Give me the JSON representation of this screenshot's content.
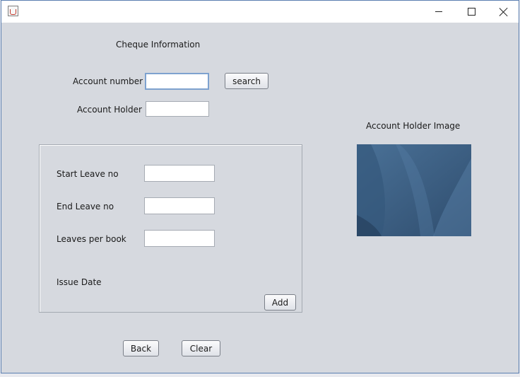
{
  "form": {
    "heading": "Cheque Information",
    "account_number": {
      "label": "Account number",
      "value": ""
    },
    "search_button": "search",
    "account_holder": {
      "label": "Account Holder",
      "value": ""
    },
    "image_label": "Account Holder Image",
    "leaves_panel": {
      "start_leave": {
        "label": "Start Leave no",
        "value": ""
      },
      "end_leave": {
        "label": "End Leave no",
        "value": ""
      },
      "leaves_per_book": {
        "label": "Leaves per book",
        "value": ""
      },
      "issue_date_label": "Issue Date",
      "add_button": "Add"
    },
    "back_button": "Back",
    "clear_button": "Clear"
  },
  "icons": {
    "app": "java-cup-icon",
    "minimize": "minimize-icon",
    "maximize": "maximize-icon",
    "close": "close-icon"
  },
  "colors": {
    "window_bg": "#d6d9df",
    "focus_border": "#7ea2cf",
    "image_blue": "#3e5f82"
  }
}
